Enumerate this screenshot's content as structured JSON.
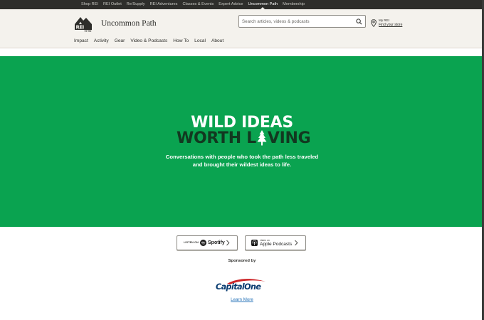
{
  "topbar": {
    "links": [
      {
        "label": "Shop REI",
        "active": false
      },
      {
        "label": "REI Outlet",
        "active": false
      },
      {
        "label": "Re/Supply",
        "active": false
      },
      {
        "label": "REI Adventures",
        "active": false
      },
      {
        "label": "Classes & Events",
        "active": false
      },
      {
        "label": "Expert Advice",
        "active": false
      },
      {
        "label": "Uncommon Path",
        "active": true
      },
      {
        "label": "Membership",
        "active": false
      }
    ]
  },
  "header": {
    "logo_text": "REI co-op",
    "site_title": "Uncommon Path",
    "search": {
      "placeholder": "Search articles, videos & podcasts",
      "value": ""
    },
    "store": {
      "label": "My REI",
      "link": "Find your store"
    }
  },
  "mainnav": {
    "items": [
      "Impact",
      "Activity",
      "Gear",
      "Video & Podcasts",
      "How To",
      "Local",
      "About"
    ]
  },
  "hero": {
    "line1": "WILD IDEAS",
    "line2_start": "WORTH L",
    "line2_end": "VING",
    "description": "Conversations with people who took the path less traveled and brought their wildest ideas to life.",
    "colors": {
      "background": "#0aa350",
      "line2": "#123820"
    }
  },
  "podcasts": {
    "spotify": {
      "prefix": "LISTEN ON",
      "name": "Spotify",
      "icon": "spotify-icon"
    },
    "apple": {
      "prefix": "Listen on",
      "name": "Apple Podcasts",
      "icon": "apple-podcasts-icon"
    }
  },
  "sponsor": {
    "heading": "Sponsored by",
    "name": "CapitalOne",
    "link": "Learn More"
  }
}
